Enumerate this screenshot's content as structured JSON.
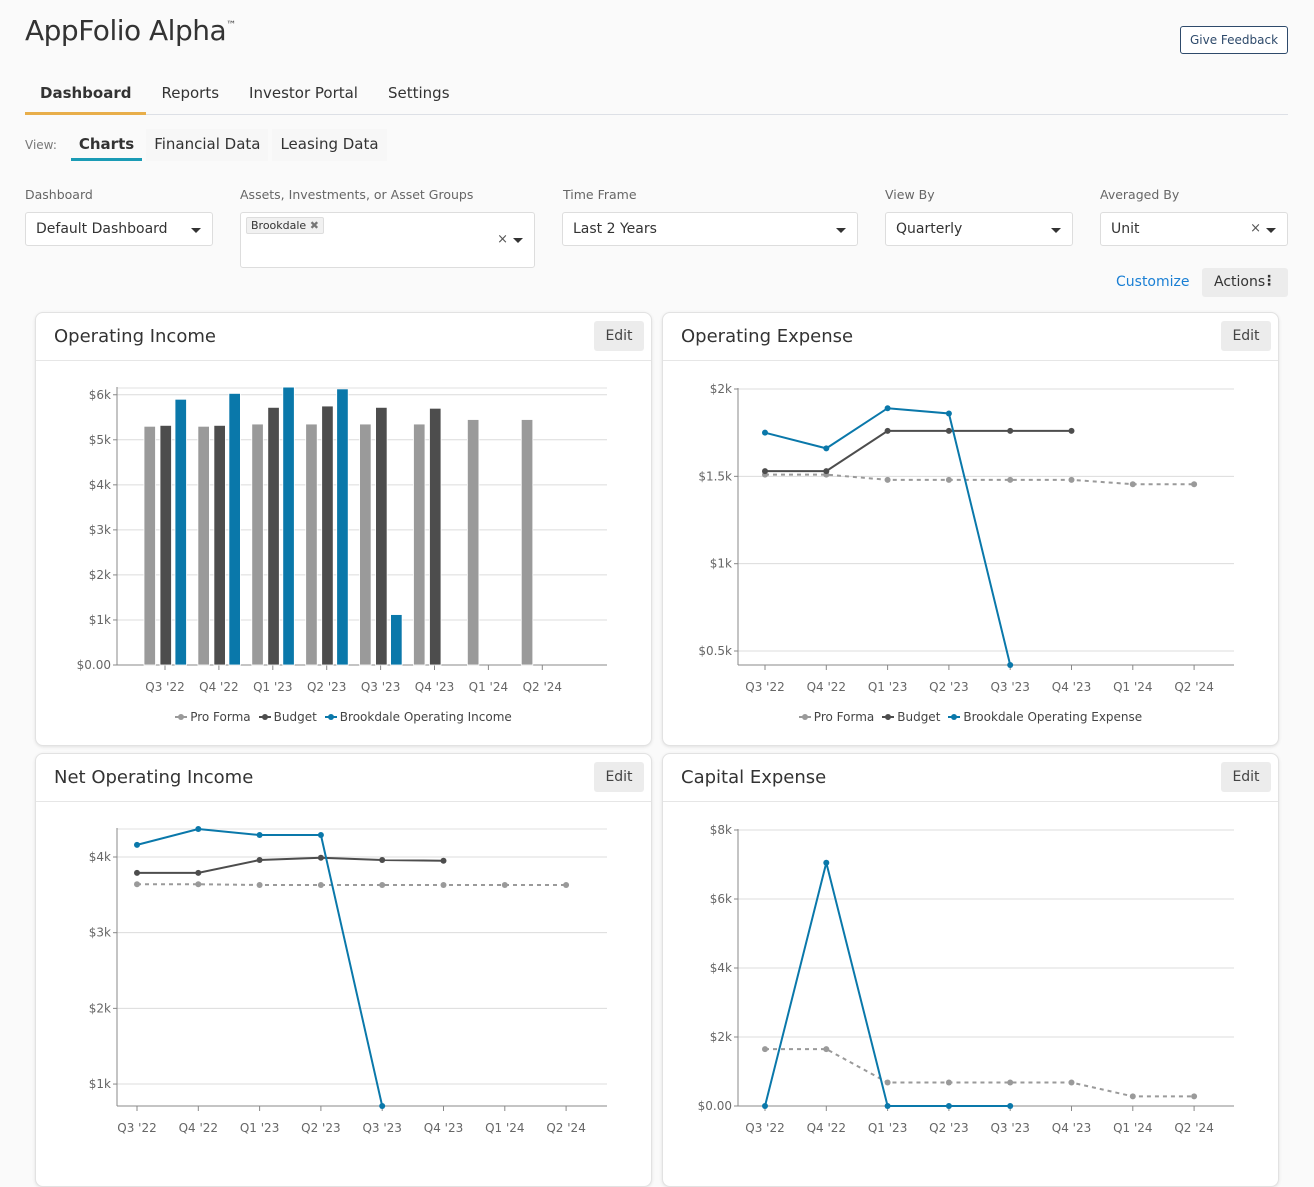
{
  "app": {
    "title": "AppFolio Alpha",
    "trademark": "™",
    "feedback_label": "Give Feedback"
  },
  "nav": {
    "tabs": [
      {
        "label": "Dashboard",
        "active": true
      },
      {
        "label": "Reports"
      },
      {
        "label": "Investor Portal"
      },
      {
        "label": "Settings"
      }
    ]
  },
  "view": {
    "label": "View:",
    "tabs": [
      {
        "label": "Charts",
        "active": true
      },
      {
        "label": "Financial Data"
      },
      {
        "label": "Leasing Data"
      }
    ]
  },
  "filters": {
    "dashboard": {
      "label": "Dashboard",
      "value": "Default Dashboard"
    },
    "assets": {
      "label": "Assets, Investments, or Asset Groups",
      "chips": [
        "Brookdale"
      ]
    },
    "time_frame": {
      "label": "Time Frame",
      "value": "Last 2 Years"
    },
    "view_by": {
      "label": "View By",
      "value": "Quarterly"
    },
    "averaged_by": {
      "label": "Averaged By",
      "value": "Unit"
    }
  },
  "toolbar": {
    "customize": "Customize",
    "actions": "Actions"
  },
  "edit_label": "Edit",
  "colors": {
    "pro_forma": "#9a9a9a",
    "budget": "#4d4d4d",
    "actual": "#0a78aa",
    "accent": "#e8ae4a",
    "view_accent": "#1a9bb5"
  },
  "chart_data": [
    {
      "title": "Operating Income",
      "type": "bar",
      "categories": [
        "Q3 '22",
        "Q4 '22",
        "Q1 '23",
        "Q2 '23",
        "Q3 '23",
        "Q4 '23",
        "Q1 '24",
        "Q2 '24"
      ],
      "yticks": [
        "$0.00",
        "$1k",
        "$2k",
        "$3k",
        "$4k",
        "$5k",
        "$6k"
      ],
      "ylim": [
        0,
        6150
      ],
      "grid": true,
      "legend": "bottom",
      "series": [
        {
          "name": "Pro Forma",
          "values": [
            5300,
            5300,
            5350,
            5350,
            5350,
            5350,
            5450,
            5450
          ]
        },
        {
          "name": "Budget",
          "values": [
            5320,
            5320,
            5720,
            5750,
            5720,
            5700,
            null,
            null
          ]
        },
        {
          "name": "Brookdale Operating Income",
          "values": [
            5900,
            6030,
            6170,
            6130,
            1120,
            null,
            null,
            null
          ]
        }
      ]
    },
    {
      "title": "Operating Expense",
      "type": "line",
      "categories": [
        "Q3 '22",
        "Q4 '22",
        "Q1 '23",
        "Q2 '23",
        "Q3 '23",
        "Q4 '23",
        "Q1 '24",
        "Q2 '24"
      ],
      "yticks": [
        "$0.5k",
        "$1k",
        "$1.5k",
        "$2k"
      ],
      "ylim": [
        420,
        2000
      ],
      "grid": true,
      "legend": "bottom",
      "series": [
        {
          "name": "Pro Forma",
          "values": [
            1510,
            1510,
            1480,
            1480,
            1480,
            1480,
            1455,
            1455
          ]
        },
        {
          "name": "Budget",
          "values": [
            1530,
            1530,
            1760,
            1760,
            1760,
            1760,
            null,
            null
          ]
        },
        {
          "name": "Brookdale Operating Expense",
          "values": [
            1750,
            1660,
            1890,
            1860,
            420,
            null,
            null,
            null
          ]
        }
      ]
    },
    {
      "title": "Net Operating Income",
      "type": "line",
      "categories": [
        "Q3 '22",
        "Q4 '22",
        "Q1 '23",
        "Q2 '23",
        "Q3 '23",
        "Q4 '23",
        "Q1 '24",
        "Q2 '24"
      ],
      "yticks": [
        "$1k",
        "$2k",
        "$3k",
        "$4k"
      ],
      "ylim": [
        710,
        4370
      ],
      "grid": true,
      "series": [
        {
          "values": [
            3640,
            3640,
            3630,
            3630,
            3630,
            3630,
            3630,
            3630
          ]
        },
        {
          "values": [
            3790,
            3790,
            3960,
            3990,
            3960,
            3950,
            null,
            null
          ]
        },
        {
          "values": [
            4160,
            4370,
            4290,
            4290,
            710,
            null,
            null,
            null
          ]
        }
      ]
    },
    {
      "title": "Capital Expense",
      "type": "line",
      "categories": [
        "Q3 '22",
        "Q4 '22",
        "Q1 '23",
        "Q2 '23",
        "Q3 '23",
        "Q4 '23",
        "Q1 '24",
        "Q2 '24"
      ],
      "yticks": [
        "$0.00",
        "$2k",
        "$4k",
        "$6k",
        "$8k"
      ],
      "ylim": [
        0,
        8000
      ],
      "grid": true,
      "series": [
        {
          "values": [
            1650,
            1650,
            680,
            680,
            680,
            680,
            280,
            280
          ]
        },
        {
          "values": [
            null,
            null,
            null,
            null,
            null,
            null,
            null,
            null
          ]
        },
        {
          "values": [
            0,
            7050,
            0,
            0,
            0,
            null,
            null,
            null
          ]
        }
      ]
    }
  ]
}
